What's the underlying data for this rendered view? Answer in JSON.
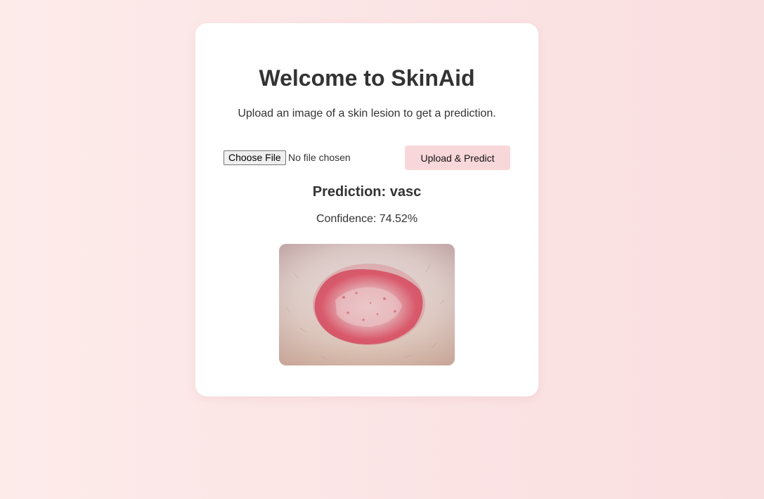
{
  "header": {
    "title": "Welcome to SkinAid",
    "subtitle": "Upload an image of a skin lesion to get a prediction."
  },
  "upload": {
    "choose_file_label": "Choose File",
    "file_status": "No file chosen",
    "submit_label": "Upload & Predict"
  },
  "result": {
    "prediction_text": "Prediction: vasc",
    "confidence_text": "Confidence: 74.52%",
    "image_description_icon": "skin-lesion-photo"
  },
  "colors": {
    "background": "#fbe3e4",
    "card": "#ffffff",
    "button": "#f8d7da",
    "text": "#333333"
  }
}
